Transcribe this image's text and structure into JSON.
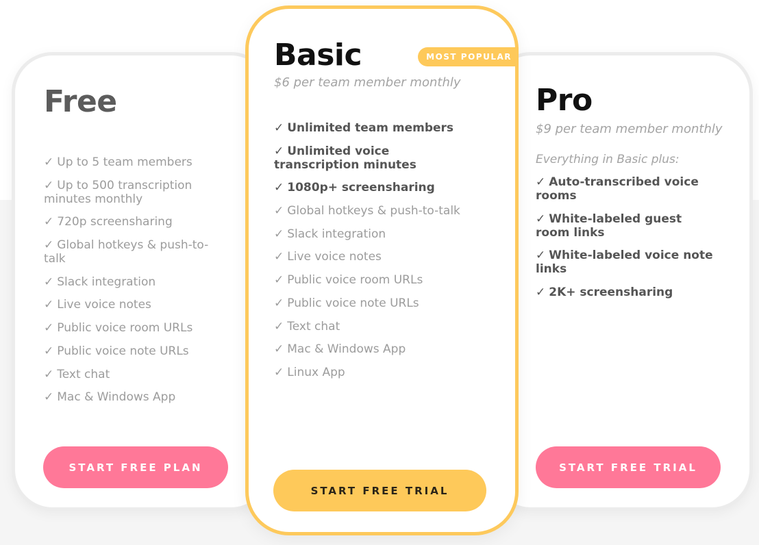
{
  "colors": {
    "accent_pink": "#ff7898",
    "accent_yellow": "#fec95a",
    "title_dark": "#111111",
    "title_muted": "#5c5c5c",
    "feature_muted": "#9c9c9c",
    "feature_bold": "#555555"
  },
  "plans": {
    "free": {
      "title": "Free",
      "features": [
        {
          "check": "✓",
          "text": "Up to 5 team members"
        },
        {
          "check": "✓",
          "text": "Up to 500 transcription minutes monthly"
        },
        {
          "check": "✓",
          "text": "720p screensharing"
        },
        {
          "check": "✓",
          "text": "Global hotkeys & push-to-talk"
        },
        {
          "check": "✓",
          "text": "Slack integration"
        },
        {
          "check": "✓",
          "text": "Live voice notes"
        },
        {
          "check": "✓",
          "text": "Public voice room URLs"
        },
        {
          "check": "✓",
          "text": "Public voice note URLs"
        },
        {
          "check": "✓",
          "text": "Text chat"
        },
        {
          "check": "✓",
          "text": "Mac & Windows App"
        }
      ],
      "cta_label": "START FREE PLAN"
    },
    "basic": {
      "title": "Basic",
      "badge": "MOST POPULAR",
      "price": "$6 per team member monthly",
      "features": [
        {
          "check": "✓",
          "text": "Unlimited team members",
          "emphasis": true
        },
        {
          "check": "✓",
          "text": "Unlimited voice transcription minutes",
          "emphasis": true
        },
        {
          "check": "✓",
          "text": "1080p+ screensharing",
          "emphasis": true
        },
        {
          "check": "✓",
          "text": "Global hotkeys & push-to-talk"
        },
        {
          "check": "✓",
          "text": "Slack integration"
        },
        {
          "check": "✓",
          "text": "Live voice notes"
        },
        {
          "check": "✓",
          "text": "Public voice room URLs"
        },
        {
          "check": "✓",
          "text": "Public voice note URLs"
        },
        {
          "check": "✓",
          "text": "Text chat"
        },
        {
          "check": "✓",
          "text": "Mac & Windows App"
        },
        {
          "check": "✓",
          "text": "Linux App"
        }
      ],
      "cta_label": "START FREE TRIAL"
    },
    "pro": {
      "title": "Pro",
      "price": "$9 per team member monthly",
      "note": "Everything in Basic plus:",
      "features": [
        {
          "check": "✓",
          "text": "Auto-transcribed voice rooms",
          "emphasis": true
        },
        {
          "check": "✓",
          "text": "White-labeled guest room links",
          "emphasis": true
        },
        {
          "check": "✓",
          "text": "White-labeled voice note links",
          "emphasis": true
        },
        {
          "check": "✓",
          "text": "2K+ screensharing",
          "emphasis": true
        }
      ],
      "cta_label": "START FREE TRIAL"
    }
  }
}
